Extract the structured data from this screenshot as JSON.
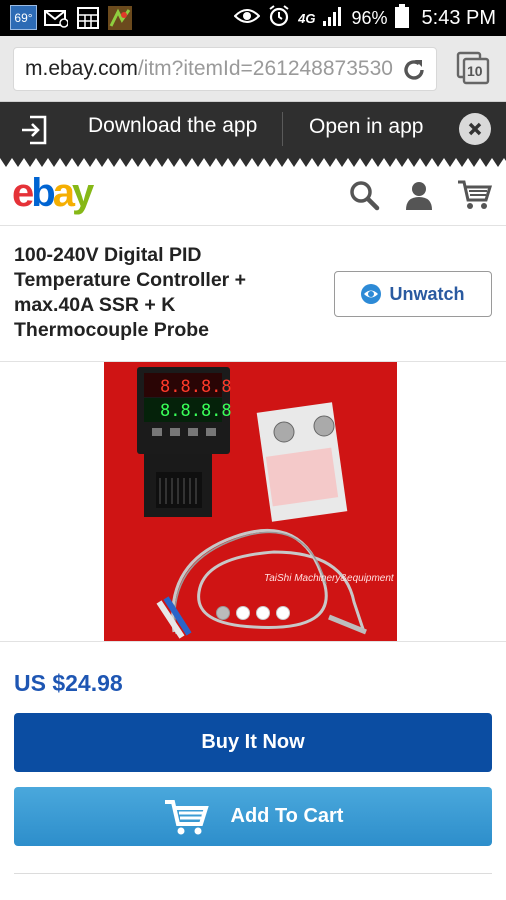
{
  "status_bar": {
    "temperature": "69°",
    "battery_percent": "96%",
    "network": "4G",
    "time": "5:43 PM"
  },
  "browser": {
    "url_host": "m.ebay.com",
    "url_path": "/itm?itemId=261248873530",
    "tab_count": "10"
  },
  "app_banner": {
    "download_label": "Download the app",
    "open_label": "Open in app"
  },
  "header": {
    "logo_letters": [
      "e",
      "b",
      "a",
      "y"
    ],
    "logo_colors": [
      "#e53238",
      "#0064d2",
      "#f5af02",
      "#86b817"
    ]
  },
  "listing": {
    "title": "100-240V Digital PID Temperature Controller + max.40A SSR + K Thermocouple Probe",
    "watch_label": "Unwatch",
    "image_watermark": "TaiShi Machinery&equipment",
    "image_count": 4,
    "active_image_index": 0,
    "price": "US $24.98",
    "buy_label": "Buy It Now",
    "cart_label": "Add To Cart"
  },
  "colors": {
    "brand_blue": "#0b4da2",
    "cart_blue": "#3a9bd4",
    "price_blue": "#1e56b3",
    "banner_dark": "#2f2f2f",
    "image_red": "#cf1414"
  }
}
